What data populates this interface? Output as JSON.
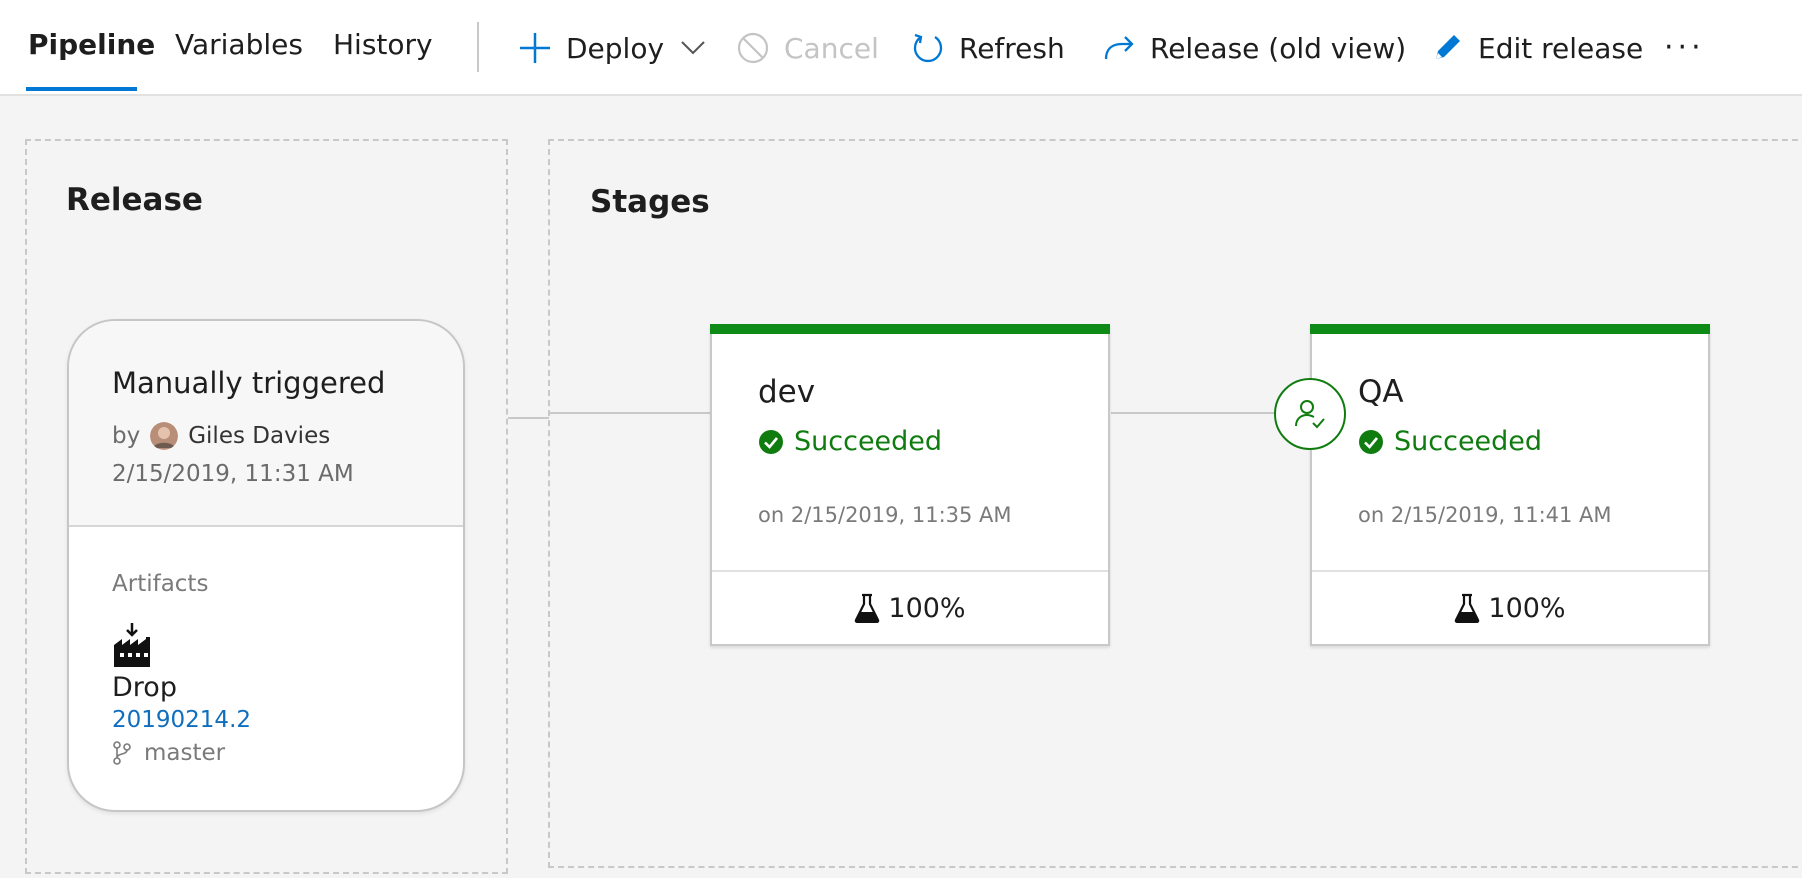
{
  "tabs": [
    {
      "label": "Pipeline",
      "active": true
    },
    {
      "label": "Variables",
      "active": false
    },
    {
      "label": "History",
      "active": false
    }
  ],
  "commands": {
    "deploy": "Deploy",
    "cancel": "Cancel",
    "refresh": "Refresh",
    "release_old_view": "Release (old view)",
    "edit_release": "Edit release",
    "more": "···"
  },
  "release_panel": {
    "title": "Release",
    "trigger": "Manually triggered",
    "by_label": "by",
    "user": "Giles Davies",
    "date": "2/15/2019, 11:31 AM",
    "artifacts_label": "Artifacts",
    "artifact_name": "Drop",
    "artifact_build": "20190214.2",
    "artifact_branch": "master"
  },
  "stages_panel": {
    "title": "Stages",
    "stages": [
      {
        "name": "dev",
        "status": "Succeeded",
        "time": "on 2/15/2019, 11:35 AM",
        "tests": "100%"
      },
      {
        "name": "QA",
        "status": "Succeeded",
        "time": "on 2/15/2019, 11:41 AM",
        "tests": "100%"
      }
    ]
  },
  "colors": {
    "accent": "#0078d4",
    "success": "#107c10",
    "success_bar": "#0e8a16",
    "link": "#106ebe"
  },
  "icons": [
    "plus-icon",
    "chevron-down-icon",
    "cancel-icon",
    "refresh-icon",
    "redo-arrow-icon",
    "pencil-icon",
    "more-icon",
    "artifact-build-icon",
    "branch-icon",
    "check-circle-icon",
    "flask-icon",
    "approver-icon"
  ]
}
